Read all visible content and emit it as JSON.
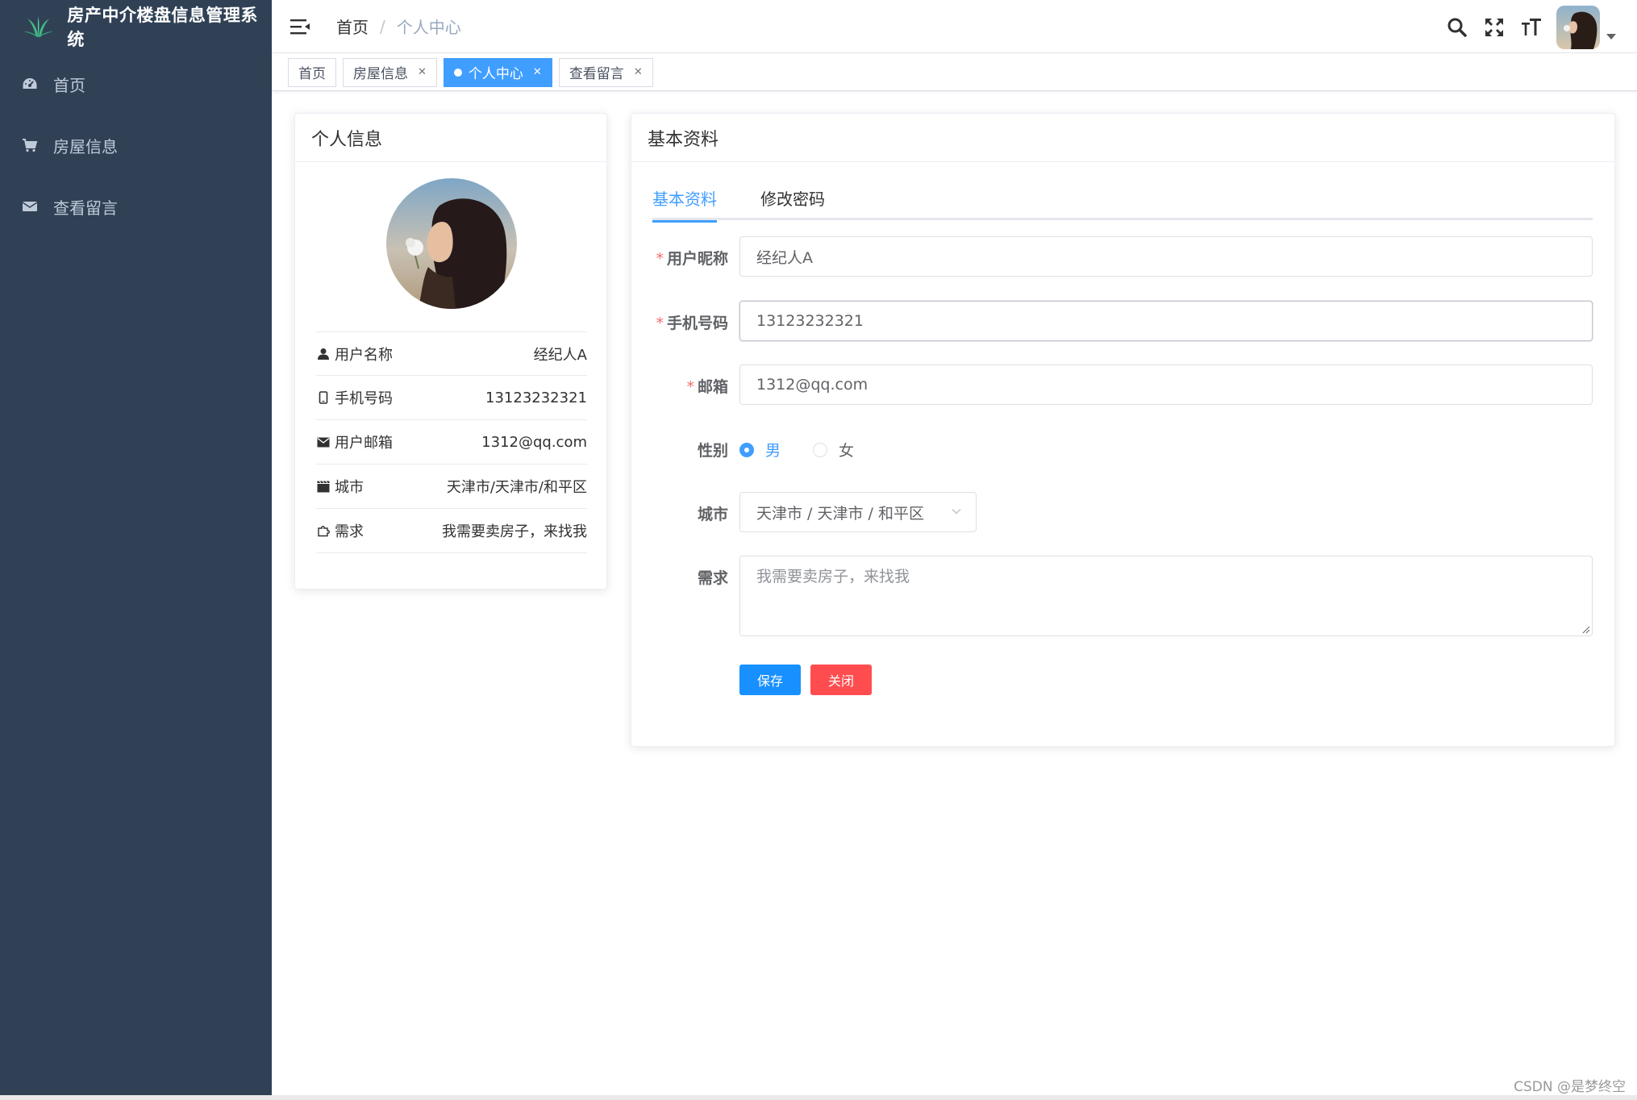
{
  "app": {
    "title": "房产中介楼盘信息管理系统"
  },
  "sidebar": {
    "items": [
      {
        "label": "首页",
        "icon": "dashboard-icon"
      },
      {
        "label": "房屋信息",
        "icon": "cart-icon"
      },
      {
        "label": "查看留言",
        "icon": "envelope-icon"
      }
    ]
  },
  "header": {
    "breadcrumb": {
      "home": "首页",
      "separator": "/",
      "current": "个人中心"
    },
    "icons": [
      "search-icon",
      "fullscreen-icon",
      "font-size-icon"
    ]
  },
  "tags": [
    {
      "label": "首页",
      "closable": false,
      "active": false
    },
    {
      "label": "房屋信息",
      "closable": true,
      "active": false
    },
    {
      "label": "个人中心",
      "closable": true,
      "active": true
    },
    {
      "label": "查看留言",
      "closable": true,
      "active": false
    }
  ],
  "profile": {
    "title": "个人信息",
    "rows": [
      {
        "label": "用户名称",
        "value": "经纪人A",
        "icon": "user-icon"
      },
      {
        "label": "手机号码",
        "value": "13123232321",
        "icon": "phone-icon"
      },
      {
        "label": "用户邮箱",
        "value": "1312@qq.com",
        "icon": "envelope-icon"
      },
      {
        "label": "城市",
        "value": "天津市/天津市/和平区",
        "icon": "clapper-icon"
      },
      {
        "label": "需求",
        "value": "我需要卖房子，来找我",
        "icon": "puzzle-icon"
      }
    ]
  },
  "basic": {
    "title": "基本资料",
    "tabs": [
      {
        "label": "基本资料",
        "active": true
      },
      {
        "label": "修改密码",
        "active": false
      }
    ],
    "form": {
      "nickname_label": "用户昵称",
      "nickname_value": "经纪人A",
      "phone_label": "手机号码",
      "phone_value": "13123232321",
      "email_label": "邮箱",
      "email_value": "1312@qq.com",
      "gender_label": "性别",
      "gender_options": [
        "男",
        "女"
      ],
      "gender_selected": "男",
      "city_label": "城市",
      "city_value": "天津市 / 天津市 / 和平区",
      "demand_label": "需求",
      "demand_value": "我需要卖房子，来找我",
      "required_mark": "*"
    },
    "buttons": {
      "save": "保存",
      "close": "关闭"
    }
  },
  "watermark": "CSDN @是梦终空",
  "colors": {
    "sidebar": "#304156",
    "primary": "#409eff",
    "danger": "#ff4d4f",
    "save": "#1890ff"
  }
}
